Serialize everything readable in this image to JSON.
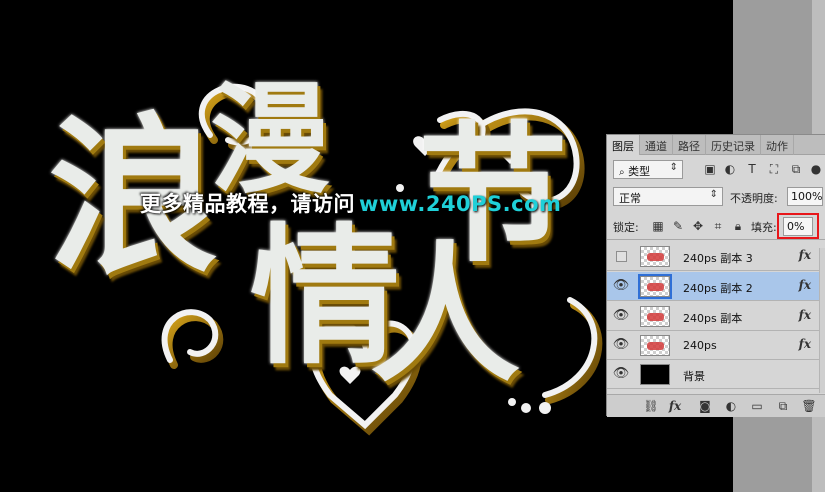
{
  "artwork": {
    "glyphs": [
      "浪",
      "漫",
      "情",
      "人",
      "节"
    ],
    "watermark_text": "更多精品教程，请访问",
    "watermark_url": "www.240PS.com"
  },
  "layers_panel": {
    "tabs": [
      {
        "label": "图层",
        "active": true
      },
      {
        "label": "通道",
        "active": false
      },
      {
        "label": "路径",
        "active": false
      },
      {
        "label": "历史记录",
        "active": false
      },
      {
        "label": "动作",
        "active": false
      }
    ],
    "filter_kind": "类型",
    "blend_mode": "正常",
    "opacity_label": "不透明度:",
    "opacity_value": "100%",
    "lock_label": "锁定:",
    "fill_label": "填充:",
    "fill_value": "0%",
    "layers": [
      {
        "name": "240ps 副本 3",
        "visible": false,
        "selected": false,
        "fx": "fx"
      },
      {
        "name": "240ps 副本 2",
        "visible": true,
        "selected": true,
        "fx": "fx"
      },
      {
        "name": "240ps 副本",
        "visible": true,
        "selected": false,
        "fx": "fx"
      },
      {
        "name": "240ps",
        "visible": true,
        "selected": false,
        "fx": "fx"
      },
      {
        "name": "背景",
        "visible": true,
        "selected": false,
        "fx": ""
      }
    ],
    "bottom_fx": "fx"
  },
  "colors": {
    "canvas_bg": "#000000",
    "selected_layer": "#a9c6ea",
    "highlight_box": "#e8161a",
    "watermark_url": "#1fd0d8"
  }
}
